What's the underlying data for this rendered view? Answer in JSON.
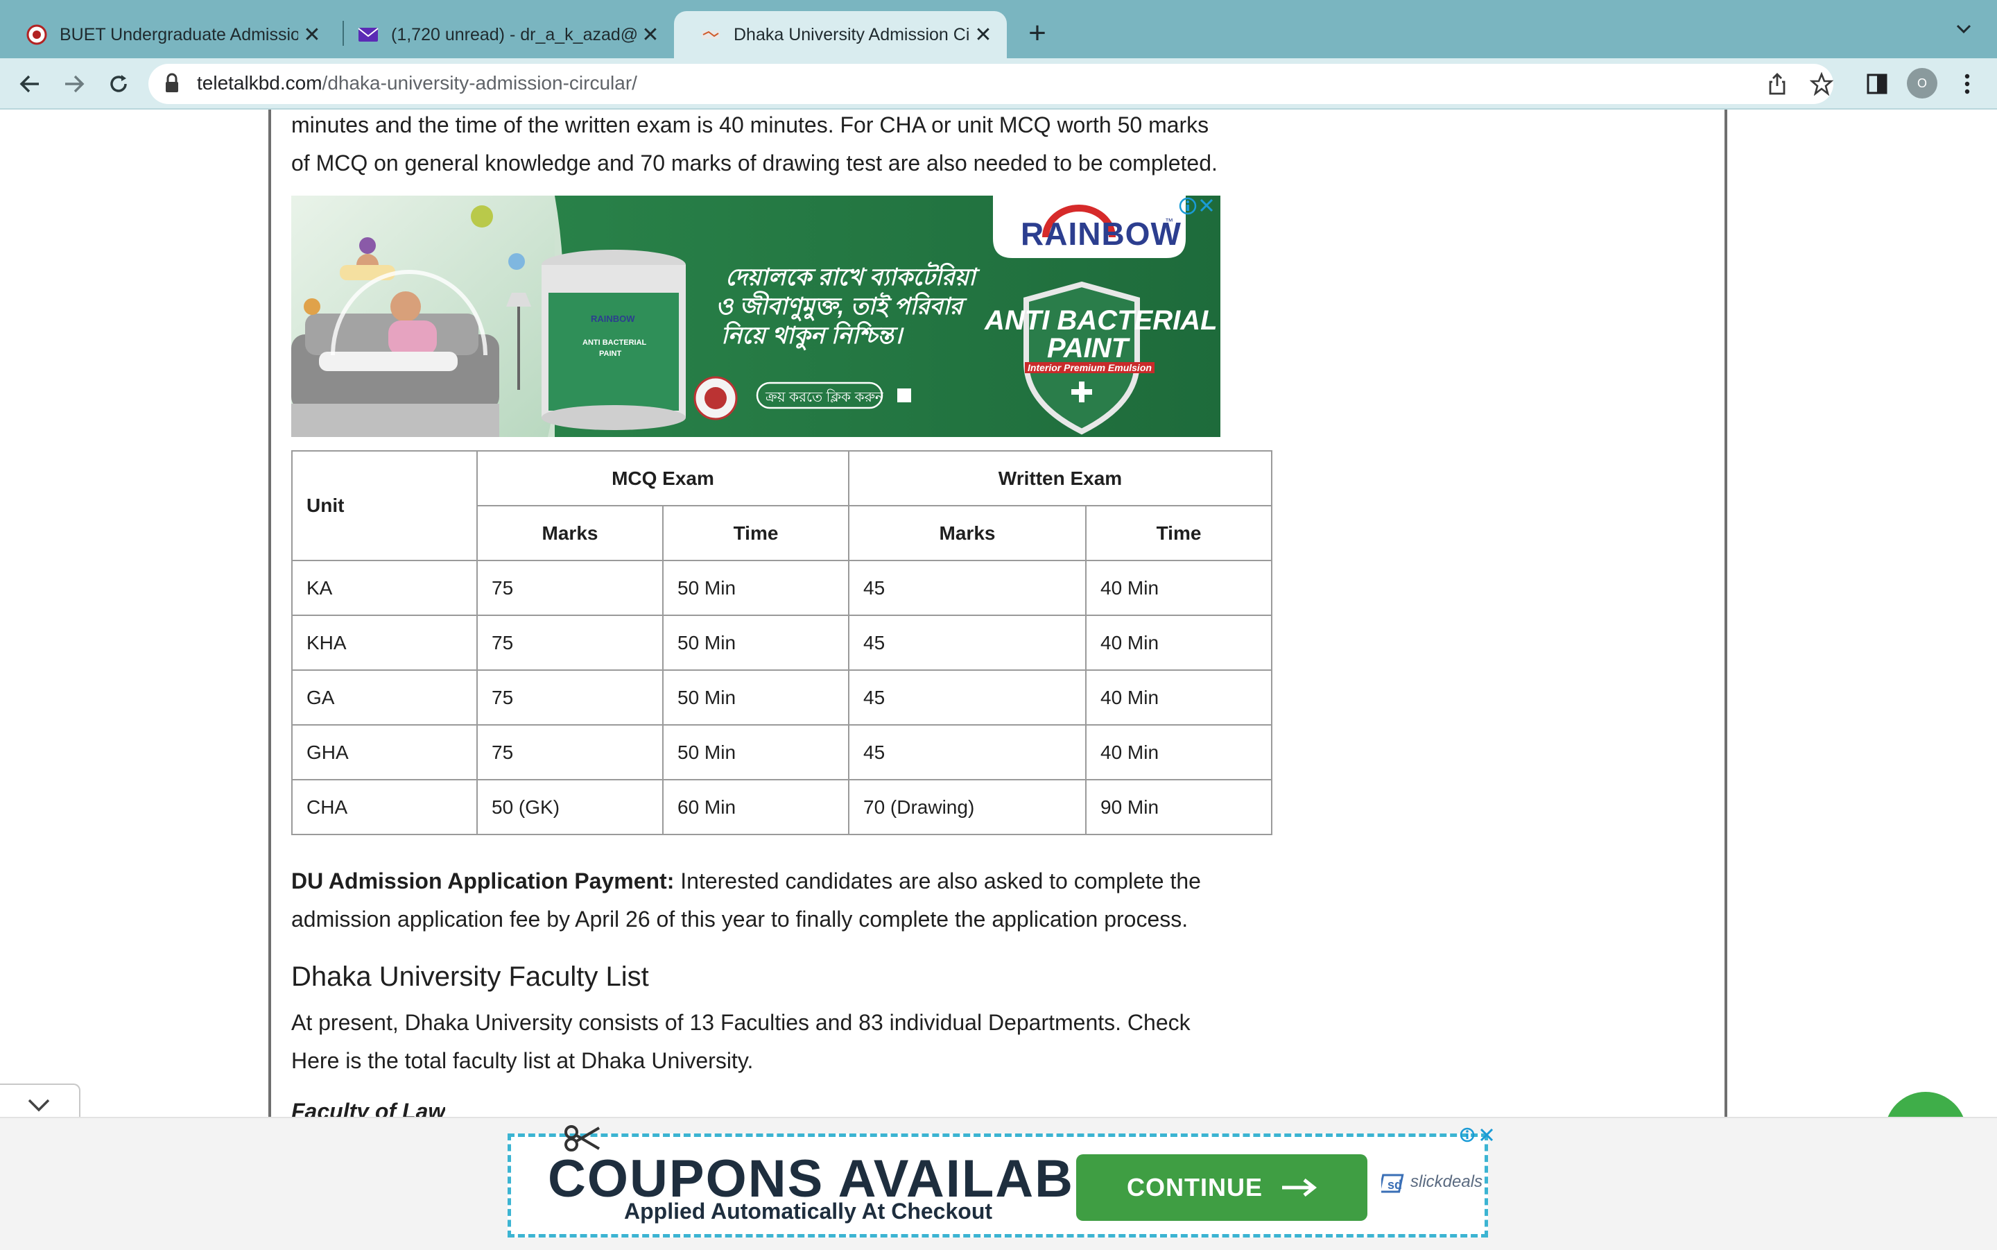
{
  "browser": {
    "tabs": [
      {
        "title": "BUET Undergraduate Admissio",
        "close": "✕"
      },
      {
        "title": "(1,720 unread) - dr_a_k_azad@",
        "close": "✕"
      },
      {
        "title": "Dhaka University Admission Ci",
        "close": "✕"
      }
    ],
    "new_tab": "+",
    "tab_menu": "⌄",
    "url_host": "teletalkbd.com",
    "url_path": "/dhaka-university-admission-circular/",
    "profile_initial": "O"
  },
  "page": {
    "intro_line1": "minutes and the time of the written exam is 40 minutes. For CHA or unit MCQ worth 50 marks",
    "intro_line2": "of MCQ on general knowledge and 70 marks of drawing test are also needed to be completed.",
    "ad": {
      "brand": "RAINBOW",
      "tm": "™",
      "bengali_line1": "দেয়ালকে রাখে ব্যাকটেরিয়া",
      "bengali_line2": "ও জীবাণুমুক্ত, তাই পরিবার",
      "bengali_line3": "নিয়ে থাকুন নিশ্চিন্ত।",
      "cta": "ক্রয় করতে ক্লিক করুন",
      "product_line1": "ANTI BACTERIAL",
      "product_line2": "PAINT",
      "product_sub": "Interior Premium Emulsion",
      "bucket_brand": "RAINBOW",
      "bucket_label1": "ANTI BACTERIAL",
      "bucket_label2": "PAINT"
    },
    "table": {
      "header_unit": "Unit",
      "header_mcq": "MCQ Exam",
      "header_written": "Written Exam",
      "sub_marks": "Marks",
      "sub_time": "Time",
      "rows": [
        {
          "unit": "KA",
          "mcq_marks": "75",
          "mcq_time": "50 Min",
          "w_marks": "45",
          "w_time": "40 Min"
        },
        {
          "unit": "KHA",
          "mcq_marks": "75",
          "mcq_time": "50 Min",
          "w_marks": "45",
          "w_time": "40 Min"
        },
        {
          "unit": "GA",
          "mcq_marks": "75",
          "mcq_time": "50 Min",
          "w_marks": "45",
          "w_time": "40 Min"
        },
        {
          "unit": "GHA",
          "mcq_marks": "75",
          "mcq_time": "50 Min",
          "w_marks": "45",
          "w_time": "40 Min"
        },
        {
          "unit": "CHA",
          "mcq_marks": "50 (GK)",
          "mcq_time": "60 Min",
          "w_marks": "70 (Drawing)",
          "w_time": "90 Min"
        }
      ]
    },
    "payment_label": "DU Admission Application Payment:",
    "payment_text1": " Interested candidates are also asked to complete the",
    "payment_text2": "admission application fee by April 26 of this year to finally complete the application process.",
    "faculty_heading": "Dhaka University Faculty List",
    "faculty_text1": "At present, Dhaka University consists of 13 Faculties and 83 individual Departments. Check",
    "faculty_text2": "Here is the total faculty list at Dhaka University.",
    "faculty_of_law": "Faculty of Law"
  },
  "bottom_ad": {
    "title": "COUPONS AVAILABLE",
    "subtitle": "Applied Automatically At Checkout",
    "button": "CONTINUE",
    "brand": "slickdeals"
  }
}
